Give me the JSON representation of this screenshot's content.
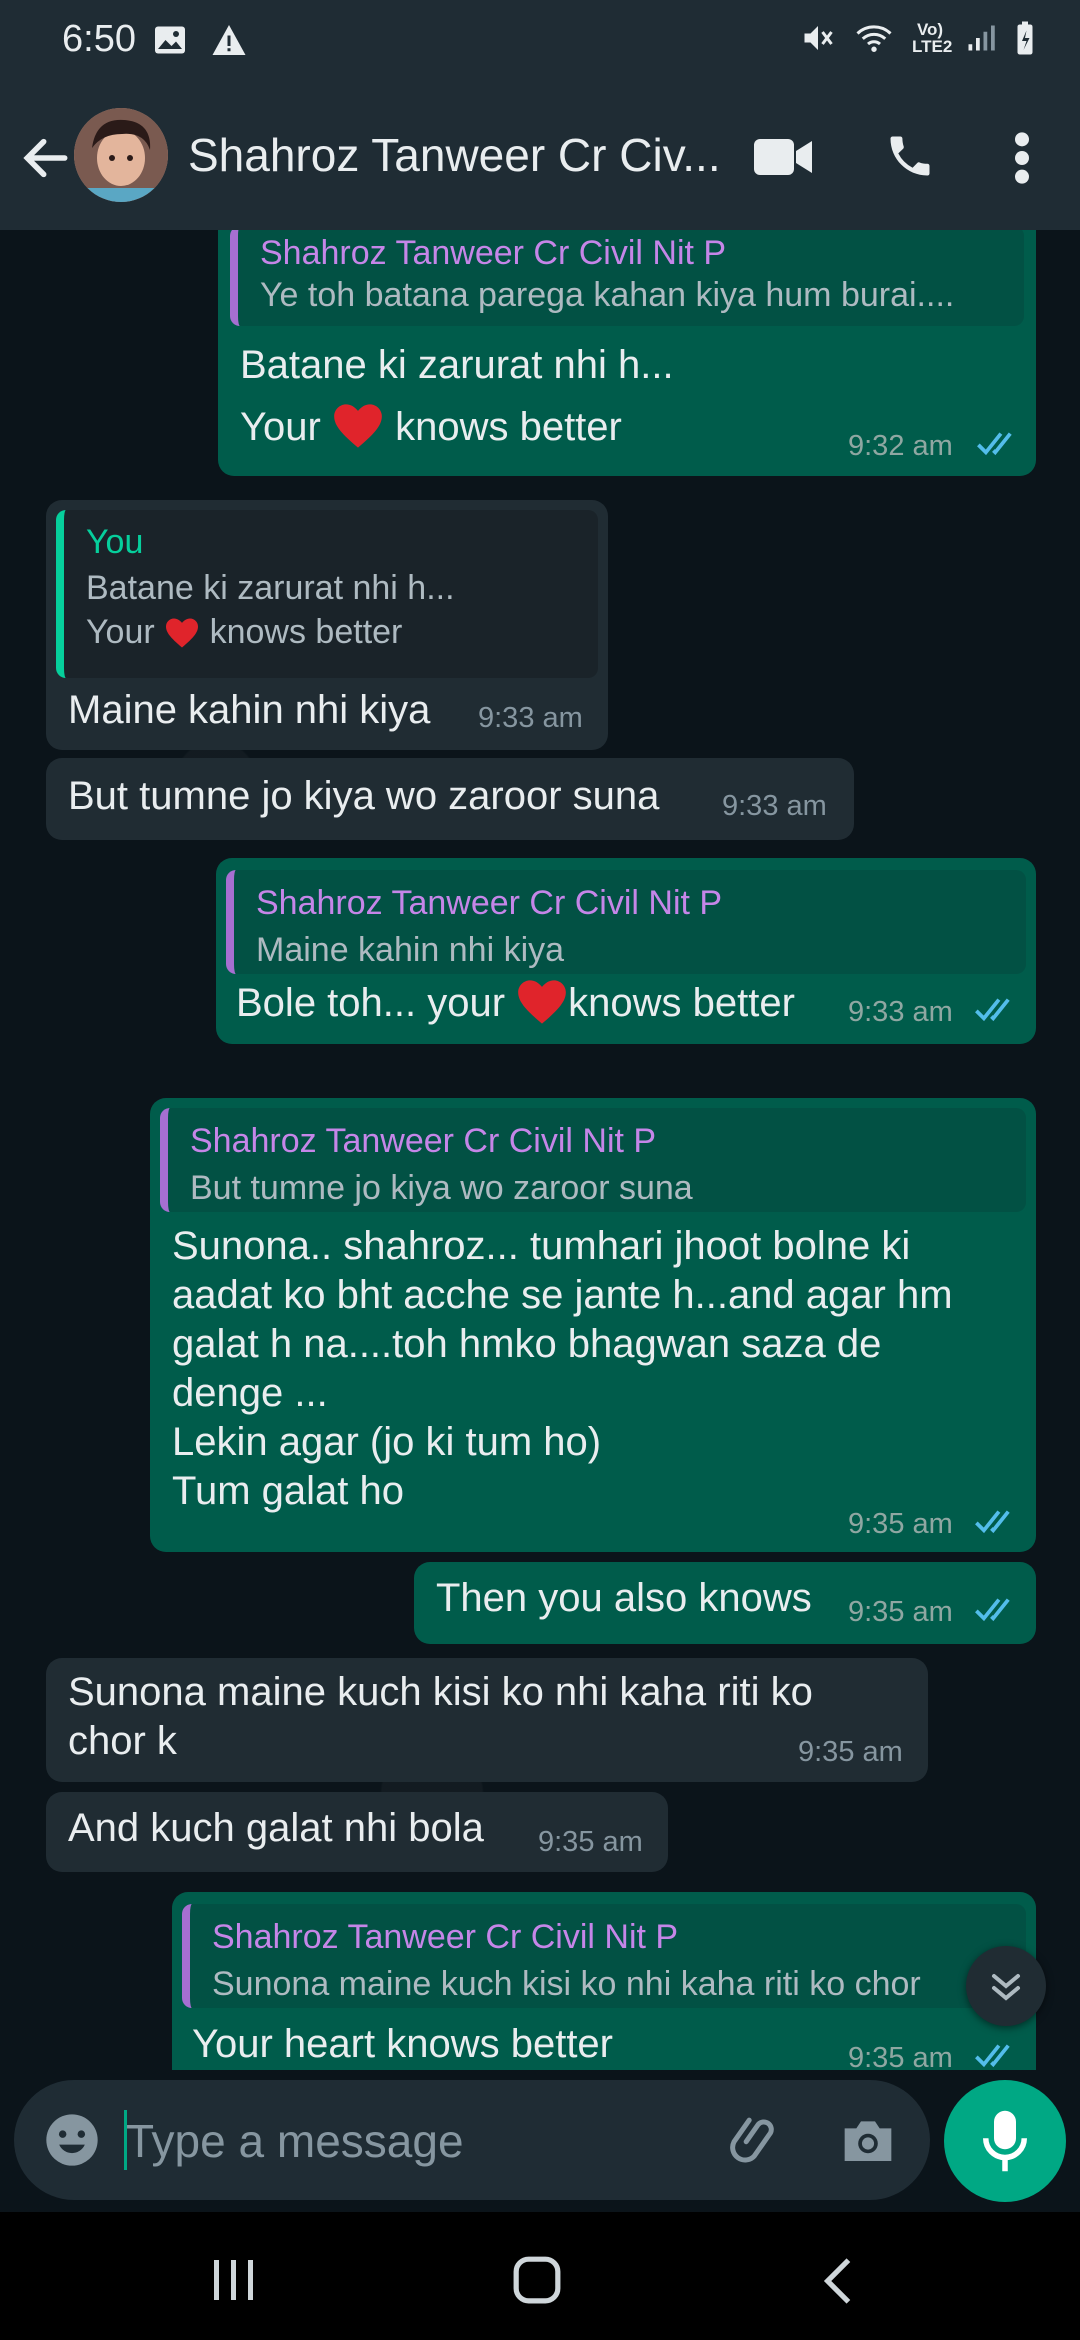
{
  "status_bar": {
    "time": "6:50",
    "network": "Vo) LTE2",
    "icons": [
      "image-icon",
      "warning-icon",
      "mute-icon",
      "wifi-icon",
      "signal-icon",
      "battery-icon"
    ]
  },
  "header": {
    "contact_name": "Shahroz Tanweer Cr Civ...",
    "icons": [
      "back-arrow-icon",
      "video-call-icon",
      "phone-call-icon",
      "more-options-icon"
    ]
  },
  "messages": [
    {
      "dir": "out",
      "quote_author": "Shahroz Tanweer Cr Civil Nit P",
      "quote_text": "Ye toh batana parega kahan kiya hum burai....",
      "line1": "Batane ki zarurat nhi h...",
      "line2_a": "Your",
      "line2_b": "knows better",
      "time": "9:32 am"
    },
    {
      "dir": "in",
      "quote_author": "You",
      "quote_line1": "Batane ki zarurat nhi h...",
      "quote_line2_a": "Your",
      "quote_line2_b": "knows better",
      "text": "Maine kahin nhi kiya",
      "time": "9:33 am"
    },
    {
      "dir": "in",
      "text": "But tumne jo kiya wo zaroor suna",
      "time": "9:33 am"
    },
    {
      "dir": "out",
      "quote_author": "Shahroz Tanweer Cr Civil Nit P",
      "quote_text": "Maine kahin nhi kiya",
      "text_a": "Bole toh... your",
      "text_b": "knows better",
      "time": "9:33 am"
    },
    {
      "dir": "out",
      "quote_author": "Shahroz Tanweer Cr Civil Nit P",
      "quote_text": "But tumne jo kiya wo zaroor suna",
      "lines": [
        "Sunona.. shahroz... tumhari jhoot bolne ki",
        "aadat ko bht acche se jante h...and agar  hm",
        "galat h na....toh hmko bhagwan saza de",
        "denge ...",
        "Lekin agar (jo ki tum ho)",
        "Tum galat ho"
      ],
      "time": "9:35 am"
    },
    {
      "dir": "out",
      "text": "Then you also knows",
      "time": "9:35 am"
    },
    {
      "dir": "in",
      "lines": [
        "Sunona maine kuch kisi ko nhi kaha riti ko",
        "chor k"
      ],
      "time": "9:35 am"
    },
    {
      "dir": "in",
      "text": "And kuch galat nhi bola",
      "time": "9:35 am"
    },
    {
      "dir": "out",
      "quote_author": "Shahroz Tanweer Cr Civil Nit P",
      "quote_text": "Sunona maine kuch kisi ko nhi kaha riti ko chor",
      "text": "Your heart knows better",
      "time": "9:35 am"
    }
  ],
  "composer": {
    "placeholder": "Type a message",
    "icons": [
      "emoji-icon",
      "attach-icon",
      "camera-icon",
      "mic-icon"
    ]
  },
  "nav_bar": {
    "icons": [
      "recents-icon",
      "home-icon",
      "back-icon"
    ]
  },
  "colors": {
    "outgoing_bubble": "#005c4b",
    "incoming_bubble": "#202c33",
    "accent": "#00a884",
    "quote_author_purple": "#c586e8",
    "read_ticks": "#53bdeb"
  }
}
